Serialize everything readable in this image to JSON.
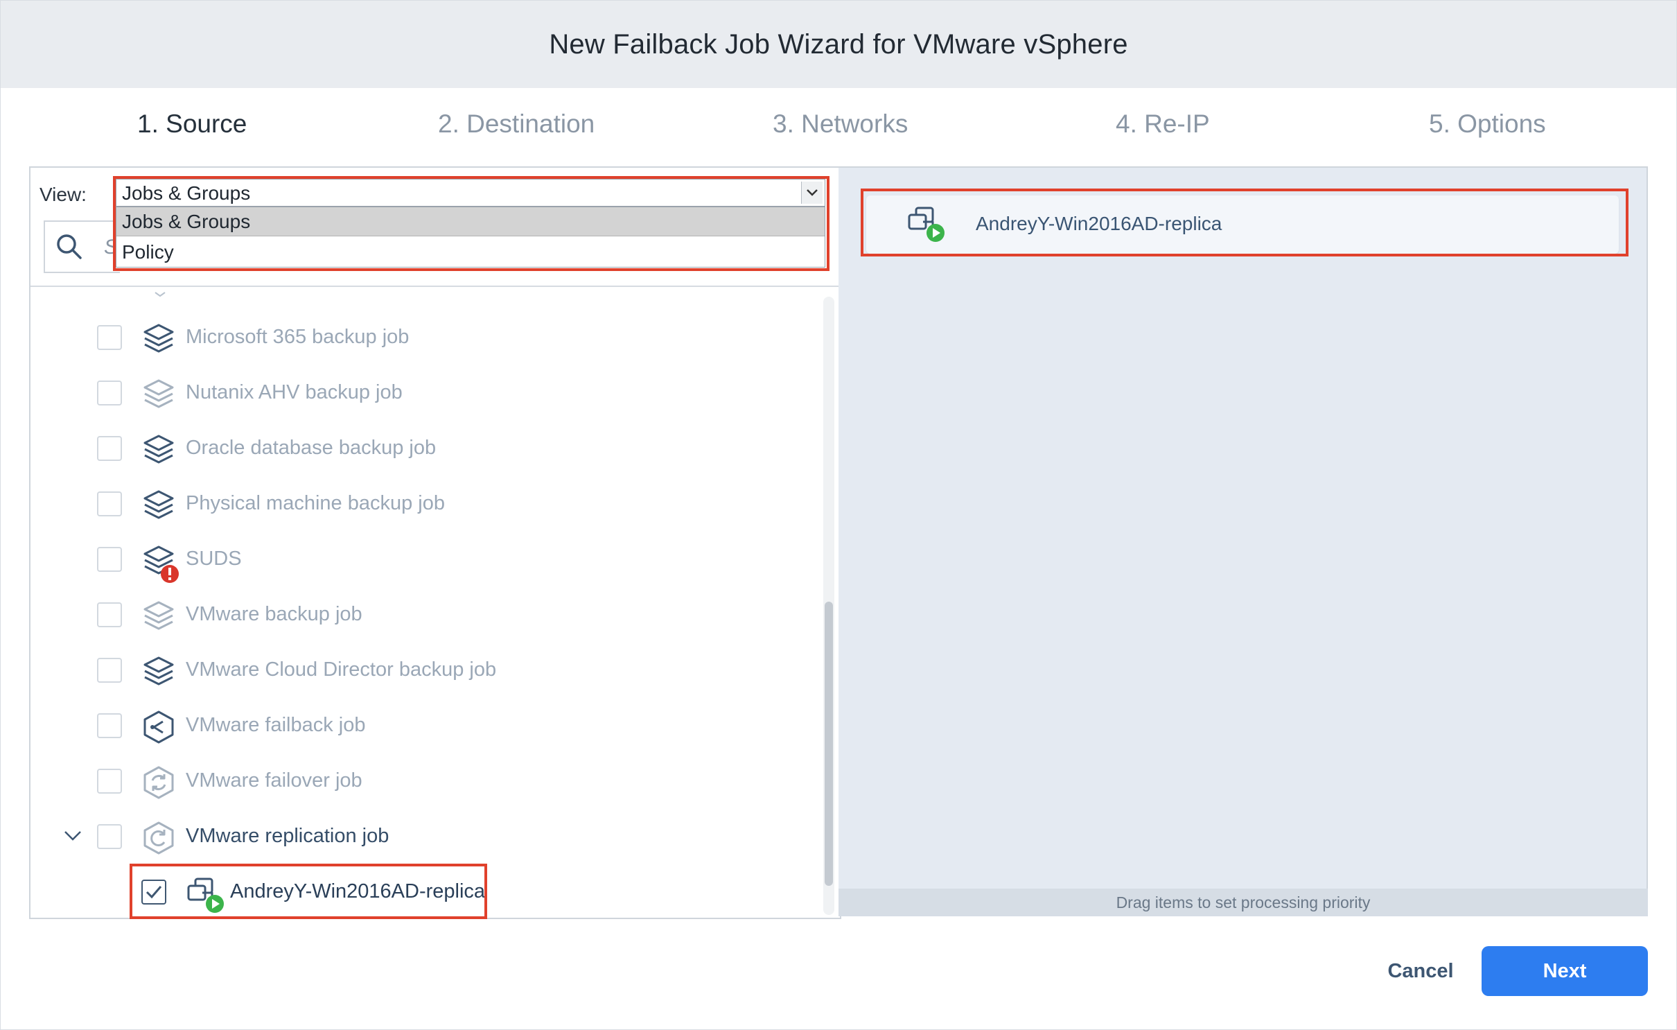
{
  "window": {
    "title": "New Failback Job Wizard for VMware vSphere"
  },
  "steps": [
    {
      "label": "1. Source",
      "active": true
    },
    {
      "label": "2. Destination",
      "active": false
    },
    {
      "label": "3. Networks",
      "active": false
    },
    {
      "label": "4. Re-IP",
      "active": false
    },
    {
      "label": "5. Options",
      "active": false
    }
  ],
  "view": {
    "label": "View:",
    "selected": "Jobs & Groups",
    "options": [
      "Jobs & Groups",
      "Policy"
    ]
  },
  "search": {
    "partial_placeholder": "S"
  },
  "tree": {
    "items": [
      {
        "label": "Microsoft 365 backup job",
        "icon": "backup-job-icon",
        "checked": false
      },
      {
        "label": "Nutanix AHV backup job",
        "icon": "backup-job-icon",
        "checked": false
      },
      {
        "label": "Oracle database backup job",
        "icon": "backup-job-icon",
        "checked": false
      },
      {
        "label": "Physical machine backup job",
        "icon": "backup-job-icon",
        "checked": false
      },
      {
        "label": "SUDS",
        "icon": "backup-job-error-icon",
        "checked": false
      },
      {
        "label": "VMware backup job",
        "icon": "backup-job-icon",
        "checked": false
      },
      {
        "label": "VMware Cloud Director backup job",
        "icon": "backup-job-icon",
        "checked": false
      },
      {
        "label": "VMware failback job",
        "icon": "failback-job-icon",
        "checked": false
      },
      {
        "label": "VMware failover job",
        "icon": "failover-job-icon",
        "checked": false
      },
      {
        "label": "VMware replication job",
        "icon": "replication-job-icon",
        "checked": false,
        "expanded": true
      },
      {
        "label": "AndreyY-Win2016AD-replica",
        "icon": "vm-replica-running-icon",
        "checked": true
      }
    ]
  },
  "selected_panel": {
    "items": [
      {
        "label": "AndreyY-Win2016AD-replica",
        "icon": "vm-replica-running-icon"
      }
    ],
    "hint": "Drag items to set processing priority"
  },
  "footer": {
    "cancel_label": "Cancel",
    "next_label": "Next"
  },
  "colors": {
    "accent": "#2d7df0",
    "highlight_box": "#e0412c",
    "running_badge": "#3cb44b",
    "error_badge": "#d9362b"
  }
}
